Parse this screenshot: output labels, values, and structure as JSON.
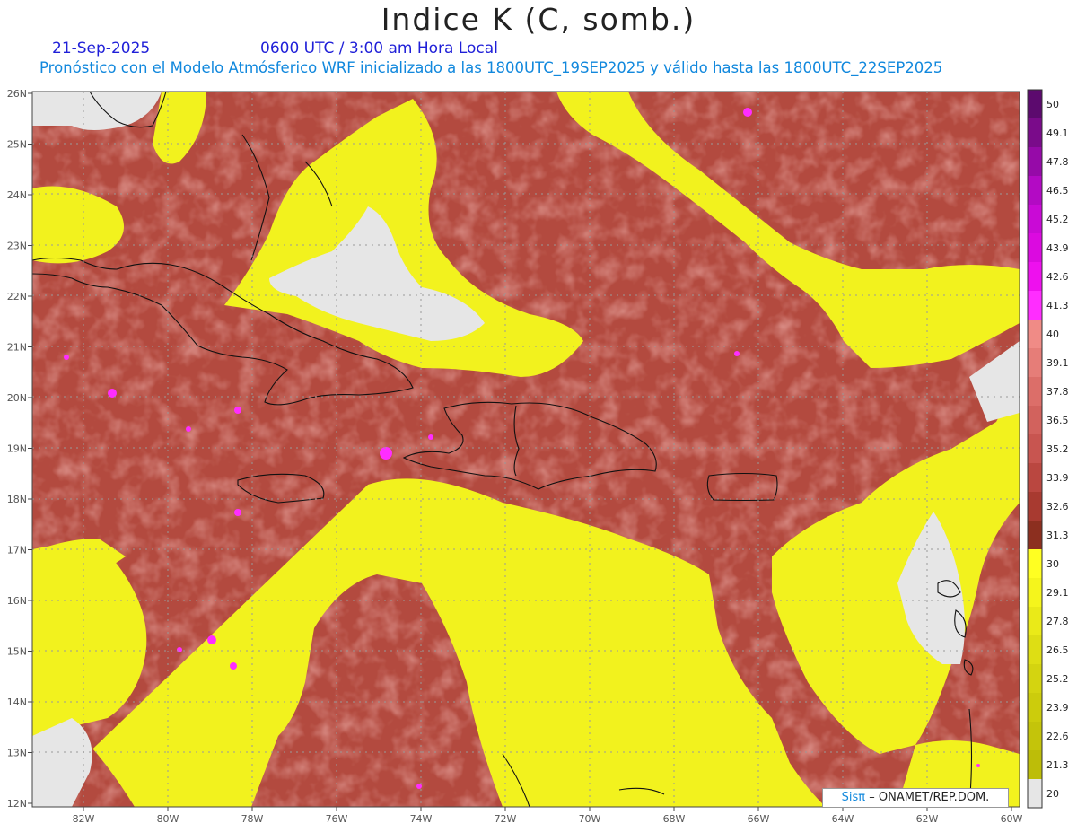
{
  "header": {
    "title": "Indice K (C, somb.)",
    "date": "21-Sep-2025",
    "time": "0600 UTC / 3:00 am Hora Local",
    "model_line": "Pronóstico con el Modelo Atmósferico WRF inicializado a las 1800UTC_19SEP2025 y válido hasta las  1800UTC_22SEP2025"
  },
  "axes": {
    "lat_labels": [
      "26N",
      "25N",
      "24N",
      "23N",
      "22N",
      "21N",
      "20N",
      "19N",
      "18N",
      "17N",
      "16N",
      "15N",
      "14N",
      "13N",
      "12N"
    ],
    "lon_labels": [
      "82W",
      "80W",
      "78W",
      "76W",
      "74W",
      "72W",
      "70W",
      "68W",
      "66W",
      "64W",
      "62W",
      "60W"
    ]
  },
  "colorbar": {
    "labels": [
      "50",
      "49.1",
      "47.8",
      "46.5",
      "45.2",
      "43.9",
      "42.6",
      "41.3",
      "40",
      "39.1",
      "37.8",
      "36.5",
      "35.2",
      "33.9",
      "32.6",
      "31.3",
      "30",
      "29.1",
      "27.8",
      "26.5",
      "25.2",
      "23.9",
      "22.6",
      "21.3",
      "20"
    ],
    "colors": [
      "#5c0a6e",
      "#7a0b8a",
      "#960aa8",
      "#b30ac4",
      "#c90ad6",
      "#db0ae0",
      "#ee10ee",
      "#ff2dff",
      "#f08b86",
      "#e67d78",
      "#dc6e69",
      "#d2625d",
      "#c85550",
      "#ba4740",
      "#a83a30",
      "#8c2f1f",
      "#ffff22",
      "#f5f51c",
      "#eaea18",
      "#dede14",
      "#d4d410",
      "#cccc0c",
      "#c4c40a",
      "#bdbd08",
      "#e6e6e6"
    ]
  },
  "credit": {
    "prefix": "Sisπ",
    "text": "– ONAMET/REP.DOM."
  }
}
